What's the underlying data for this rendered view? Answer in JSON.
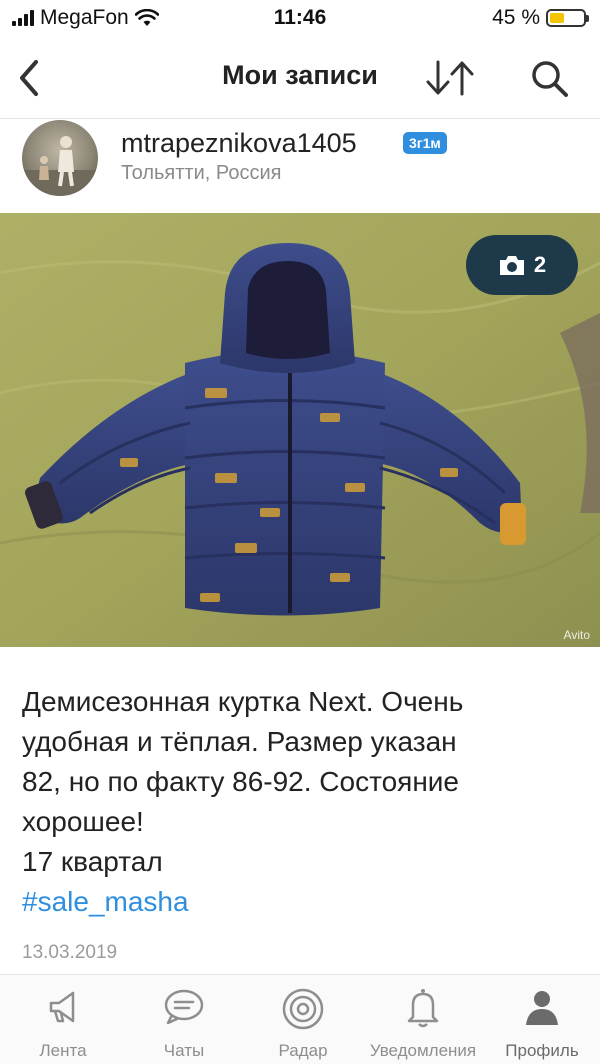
{
  "status_bar": {
    "carrier": "MegaFon",
    "time": "11:46",
    "battery": "45 %",
    "battery_level": 0.45
  },
  "nav": {
    "title": "Мои записи"
  },
  "post": {
    "author": {
      "username": "mtrapeznikova1405",
      "badge": "3г1м",
      "location": "Тольятти, Россия"
    },
    "photo": {
      "count": "2",
      "watermark": "Avito"
    },
    "text_lines": [
      "Демисезонная куртка Next. Очень",
      "удобная и тёплая. Размер указан",
      "82, но по факту 86-92. Состояние",
      "хорошее!",
      "17 квартал"
    ],
    "hashtag": "#sale_masha",
    "date": "13.03.2019"
  },
  "tabbar": {
    "items": [
      {
        "label": "Лента",
        "icon": "megaphone-icon"
      },
      {
        "label": "Чаты",
        "icon": "chat-bubble-icon"
      },
      {
        "label": "Радар",
        "icon": "radar-icon"
      },
      {
        "label": "Уведомления",
        "icon": "bell-icon"
      },
      {
        "label": "Профиль",
        "icon": "person-icon"
      }
    ],
    "active": "Профиль"
  },
  "colors": {
    "accent": "#2f8fde",
    "photo_badge": "#1e3a4a",
    "battery": "#f5c400"
  }
}
